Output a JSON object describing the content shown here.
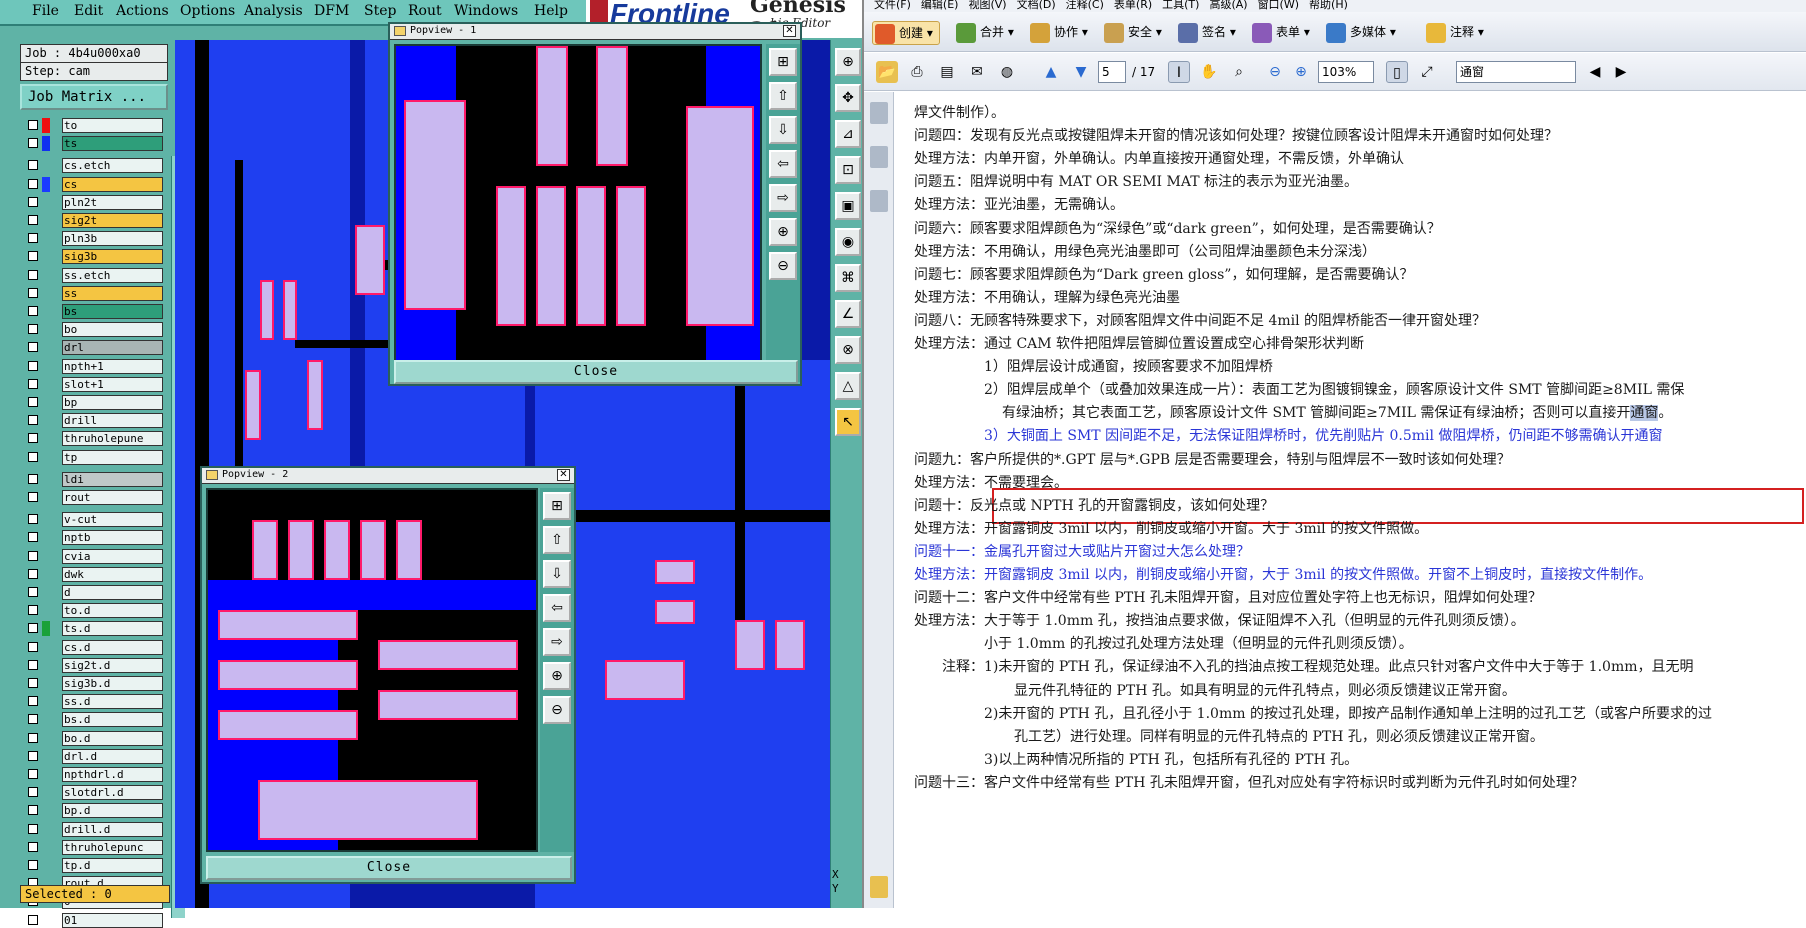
{
  "genesis": {
    "menu": [
      "File",
      "Edit",
      "Actions",
      "Options",
      "Analysis",
      "DFM",
      "Step",
      "Rout",
      "Windows",
      "Help"
    ],
    "logo": {
      "brand": "Frontline",
      "product": "Genesis 20",
      "edition": "hic Editor"
    },
    "job_label": "Job : 4b4u000xa0",
    "step_label": "Step: cam",
    "job_matrix_button": "Job Matrix ...",
    "layers": [
      {
        "name": "to",
        "style": "normal",
        "swatch": "#f01010"
      },
      {
        "name": "ts",
        "style": "act",
        "swatch": "#1030f0"
      },
      {
        "name": "cs.etch",
        "style": "normal",
        "swatch": ""
      },
      {
        "name": "cs",
        "style": "sel",
        "swatch": "#1a3bff"
      },
      {
        "name": "pln2t",
        "style": "normal",
        "swatch": ""
      },
      {
        "name": "sig2t",
        "style": "sel",
        "swatch": ""
      },
      {
        "name": "pln3b",
        "style": "normal",
        "swatch": ""
      },
      {
        "name": "sig3b",
        "style": "sel",
        "swatch": ""
      },
      {
        "name": "ss.etch",
        "style": "normal",
        "swatch": ""
      },
      {
        "name": "ss",
        "style": "sel",
        "swatch": ""
      },
      {
        "name": "bs",
        "style": "act",
        "swatch": ""
      },
      {
        "name": "bo",
        "style": "normal",
        "swatch": ""
      },
      {
        "name": "drl",
        "style": "gray",
        "swatch": ""
      },
      {
        "name": "npth+1",
        "style": "normal",
        "swatch": ""
      },
      {
        "name": "slot+1",
        "style": "normal",
        "swatch": ""
      },
      {
        "name": "bp",
        "style": "normal",
        "swatch": ""
      },
      {
        "name": "drill",
        "style": "normal",
        "swatch": ""
      },
      {
        "name": "thruholepune",
        "style": "normal",
        "swatch": ""
      },
      {
        "name": "tp",
        "style": "normal",
        "swatch": ""
      },
      {
        "name": "ldi",
        "style": "dk",
        "swatch": ""
      },
      {
        "name": "rout",
        "style": "normal",
        "swatch": ""
      },
      {
        "name": "v-cut",
        "style": "normal",
        "swatch": ""
      },
      {
        "name": "nptb",
        "style": "normal",
        "swatch": ""
      },
      {
        "name": "cvia",
        "style": "normal",
        "swatch": ""
      },
      {
        "name": "dwk",
        "style": "normal",
        "swatch": ""
      },
      {
        "name": "d",
        "style": "normal",
        "swatch": ""
      },
      {
        "name": "to.d",
        "style": "normal",
        "swatch": ""
      },
      {
        "name": "ts.d",
        "style": "normal",
        "swatch": "#1aa13a"
      },
      {
        "name": "cs.d",
        "style": "normal",
        "swatch": ""
      },
      {
        "name": "sig2t.d",
        "style": "normal",
        "swatch": ""
      },
      {
        "name": "sig3b.d",
        "style": "normal",
        "swatch": ""
      },
      {
        "name": "ss.d",
        "style": "normal",
        "swatch": ""
      },
      {
        "name": "bs.d",
        "style": "normal",
        "swatch": ""
      },
      {
        "name": "bo.d",
        "style": "normal",
        "swatch": ""
      },
      {
        "name": "drl.d",
        "style": "normal",
        "swatch": ""
      },
      {
        "name": "npthdrl.d",
        "style": "normal",
        "swatch": ""
      },
      {
        "name": "slotdrl.d",
        "style": "normal",
        "swatch": ""
      },
      {
        "name": "bp.d",
        "style": "normal",
        "swatch": ""
      },
      {
        "name": "drill.d",
        "style": "normal",
        "swatch": ""
      },
      {
        "name": "thruholepunc",
        "style": "normal",
        "swatch": ""
      },
      {
        "name": "tp.d",
        "style": "normal",
        "swatch": ""
      },
      {
        "name": "rout.d",
        "style": "normal",
        "swatch": ""
      },
      {
        "name": "0",
        "style": "normal",
        "swatch": ""
      },
      {
        "name": "01",
        "style": "normal",
        "swatch": ""
      }
    ],
    "selected_label": "Selected : 0",
    "popup1": {
      "title": "Popview - 1",
      "close": "Close"
    },
    "popup2": {
      "title": "Popview - 2",
      "close": "Close"
    },
    "coords": {
      "x": "X",
      "y": "Y"
    }
  },
  "reader": {
    "menu": [
      "文件(F)",
      "编辑(E)",
      "视图(V)",
      "文档(D)",
      "注释(C)",
      "表单(R)",
      "工具(T)",
      "高级(A)",
      "窗口(W)",
      "帮助(H)"
    ],
    "toolbar1": [
      "创建",
      "合并",
      "协作",
      "安全",
      "签名",
      "表单",
      "多媒体",
      "注释"
    ],
    "page_current": "5",
    "page_total": "/ 17",
    "zoom": "103%",
    "search_value": "通窗",
    "lines": [
      {
        "indent": 0,
        "text": "焊文件制作）。",
        "blue": false
      },
      {
        "indent": 0,
        "text": "问题四：发现有反光点或按键阻焊未开窗的情况该如何处理？按键位顾客设计阻焊未开通窗时如何处理？",
        "blue": false
      },
      {
        "indent": 0,
        "text": "处理方法：内单开窗，外单确认。内单直接按开通窗处理，不需反馈，外单确认",
        "blue": false
      },
      {
        "indent": 0,
        "text": "问题五：阻焊说明中有 MAT OR SEMI MAT 标注的表示为亚光油墨。",
        "blue": false
      },
      {
        "indent": 0,
        "text": "处理方法：亚光油墨，无需确认。",
        "blue": false
      },
      {
        "indent": 0,
        "text": "问题六：顾客要求阻焊颜色为“深绿色”或“dark green”，如何处理，是否需要确认？",
        "blue": false
      },
      {
        "indent": 0,
        "text": "处理方法：不用确认，用绿色亮光油墨即可（公司阻焊油墨颜色未分深浅）",
        "blue": false
      },
      {
        "indent": 0,
        "text": "问题七：顾客要求阻焊颜色为“Dark green gloss”，如何理解，是否需要确认？",
        "blue": false
      },
      {
        "indent": 0,
        "text": "处理方法：不用确认，理解为绿色亮光油墨",
        "blue": false
      },
      {
        "indent": 0,
        "text": "问题八：无顾客特殊要求下，对顾客阻焊文件中间距不足 4mil 的阻焊桥能否一律开窗处理？",
        "blue": false
      },
      {
        "indent": 0,
        "text": "处理方法：通过 CAM 软件把阻焊层管脚位置设置成空心排骨架形状判断",
        "blue": false
      },
      {
        "indent": 1,
        "text": "1）阻焊层设计成通窗，按顾客要求不加阻焊桥",
        "blue": false
      },
      {
        "indent": 1,
        "text": "2）阻焊层成单个（或叠加效果连成一片）：表面工艺为图镀铜镍金，顾客原设计文件 SMT 管脚间距≥8MIL 需保",
        "blue": false
      },
      {
        "indent": 2,
        "text": "有绿油桥；其它表面工艺，顾客原设计文件 SMT 管脚间距≥7MIL 需保证有绿油桥；否则可以直接开",
        "blue": false,
        "hl": "通窗",
        "tail": "。"
      },
      {
        "indent": 1,
        "text": "3）大铜面上 SMT 因间距不足，无法保证阻焊桥时，优先削贴片 0.5mil 做阻焊桥，仍间距不够需确认开通窗",
        "blue": true
      },
      {
        "indent": 0,
        "text": "问题九：客户所提供的*.GPT 层与*.GPB 层是否需要理会，特别与阻焊层不一致时该如何处理？",
        "blue": false
      },
      {
        "indent": 0,
        "text": "处理方法：不需要理会。",
        "blue": false
      },
      {
        "indent": 0,
        "text": "问题十：反光点或 NPTH 孔的开窗露铜皮，该如何处理？",
        "blue": false
      },
      {
        "indent": 0,
        "text": "处理方法：开窗露铜皮 3mil 以内，削铜皮或缩小开窗。大于 3mil 的按文件照做。",
        "blue": false
      },
      {
        "indent": 0,
        "text": "问题十一：金属孔开窗过大或贴片开窗过大怎么处理？",
        "blue": true
      },
      {
        "indent": 0,
        "text": "处理方法：开窗露铜皮 3mil 以内，削铜皮或缩小开窗，大于 3mil 的按文件照做。开窗不上铜皮时，直接按文件制作。",
        "blue": true
      },
      {
        "indent": 0,
        "text": "问题十二：客户文件中经常有些 PTH 孔未阻焊开窗，且对应位置处字符上也无标识，阻焊如何处理？",
        "blue": false
      },
      {
        "indent": 0,
        "text": "处理方法：大于等于 1.0mm 孔，按挡油点要求做，保证阻焊不入孔（但明显的元件孔则须反馈）。",
        "blue": false
      },
      {
        "indent": 1,
        "text": "小于 1.0mm 的孔按过孔处理方法处理（但明显的元件孔则须反馈）。",
        "blue": false
      },
      {
        "indent": 3,
        "text": "注释：1)未开窗的 PTH 孔，保证绿油不入孔的挡油点按工程规范处理。此点只针对客户文件中大于等于 1.0mm，且无明",
        "blue": false
      },
      {
        "indent": 4,
        "text": "显元件孔特征的 PTH 孔。如具有明显的元件孔特点，则必须反馈建议正常开窗。",
        "blue": false
      },
      {
        "indent": 1,
        "text": "2)未开窗的 PTH 孔，且孔径小于 1.0mm 的按过孔处理，即按产品制作通知单上注明的过孔工艺（或客户所要求的过",
        "blue": false
      },
      {
        "indent": 4,
        "text": "孔工艺）进行处理。同样有明显的元件孔特点的 PTH 孔，则必须反馈建议正常开窗。",
        "blue": false
      },
      {
        "indent": 1,
        "text": "3)以上两种情况所指的 PTH 孔，包括所有孔径的 PTH 孔。",
        "blue": false
      },
      {
        "indent": 0,
        "text": "问题十三：客户文件中经常有些 PTH 孔未阻焊开窗，但孔对应处有字符标识时或判断为元件孔时如何处理？",
        "blue": false
      }
    ]
  }
}
